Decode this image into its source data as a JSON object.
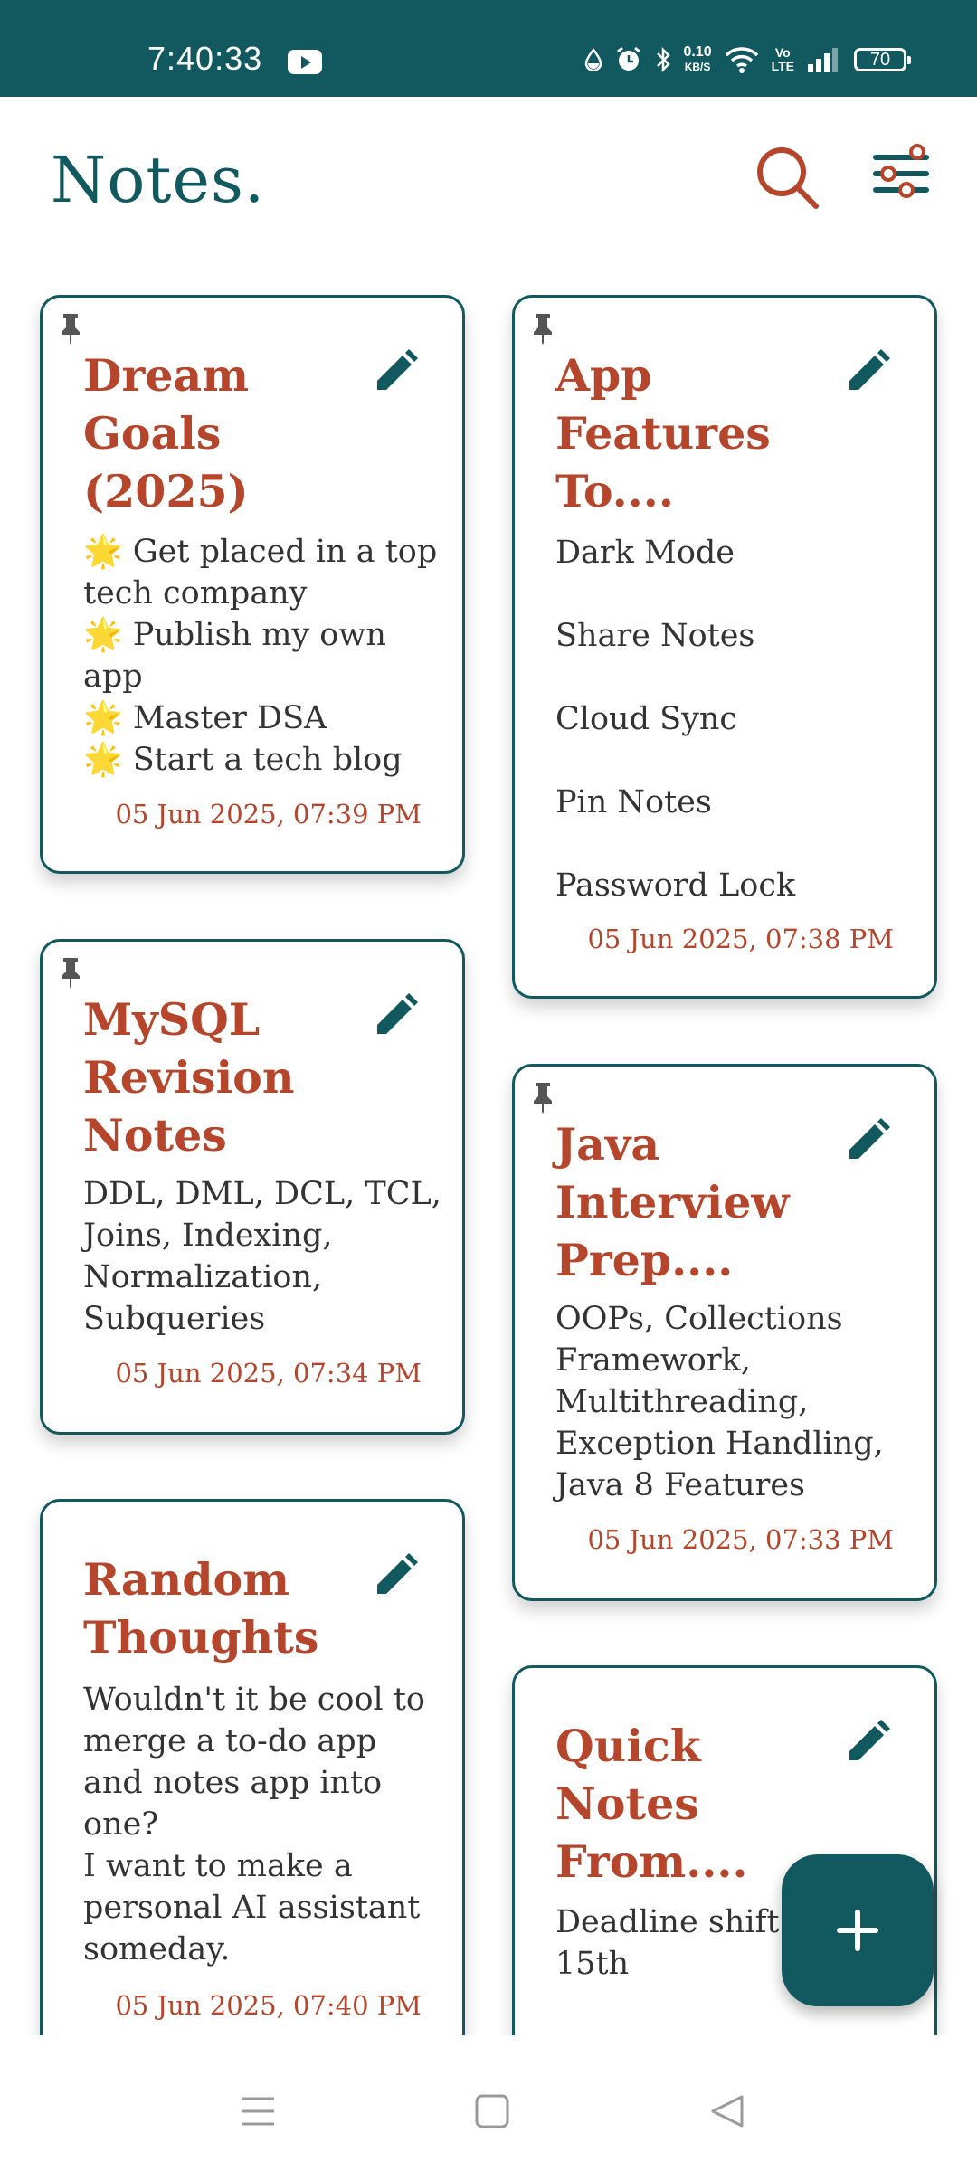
{
  "status_bar": {
    "time": "7:40:33",
    "speed_value": "0.10",
    "speed_unit": "KB/S",
    "volte_top": "Vo",
    "volte_bottom": "LTE",
    "battery": "70",
    "icons": [
      "youtube-icon",
      "drop-icon",
      "alarm-icon",
      "bluetooth-icon",
      "wifi-icon",
      "signal-icon",
      "battery-icon"
    ]
  },
  "header": {
    "title": "Notes.",
    "search_icon": "search-icon",
    "filter_icon": "filter-icon"
  },
  "colors": {
    "primary": "#12585f",
    "accent": "#b5452b",
    "text": "#333333"
  },
  "notes": [
    {
      "title": "Dream\nGoals\n(2025)",
      "body": "🌟 Get placed in a top tech company\n🌟 Publish my own app\n🌟 Master DSA\n🌟 Start a tech blog",
      "date": "05 Jun 2025, 07:39 PM",
      "pinned": true
    },
    {
      "title": "App\nFeatures\nTo....",
      "body": "Dark Mode\nShare Notes\nCloud Sync\nPin Notes\nPassword Lock",
      "date": "05 Jun 2025, 07:38 PM",
      "pinned": true
    },
    {
      "title": "MySQL\nRevision\nNotes",
      "body": "DDL, DML, DCL, TCL, Joins, Indexing, Normalization, Subqueries",
      "date": "05 Jun 2025, 07:34 PM",
      "pinned": true
    },
    {
      "title": "Java\nInterview\nPrep....",
      "body": "OOPs, Collections Framework, Multithreading, Exception Handling, Java 8 Features",
      "date": "05 Jun 2025, 07:33 PM",
      "pinned": true
    },
    {
      "title": "Random\nThoughts",
      "body": "Wouldn't it be cool to merge a to-do app and notes app into one?\nI want to make a personal AI assistant someday.",
      "date": "05 Jun 2025, 07:40 PM",
      "pinned": false
    },
    {
      "title": "Quick\nNotes\nFrom....",
      "body": "Deadline shift\n15th",
      "date": "",
      "pinned": false
    }
  ],
  "fab": {
    "icon": "plus-icon"
  },
  "nav_bar": {
    "icons": [
      "menu-icon",
      "home-icon",
      "back-icon"
    ]
  }
}
